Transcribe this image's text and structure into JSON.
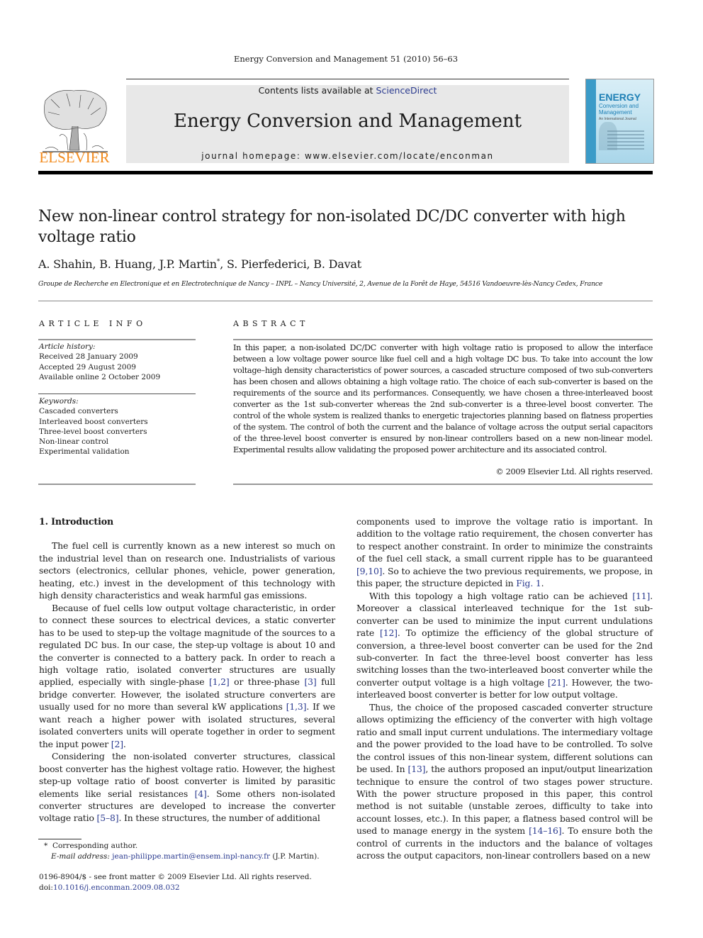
{
  "running_head": "Energy Conversion and Management 51 (2010) 56–63",
  "masthead": {
    "contents_prefix": "Contents lists available at ",
    "contents_link": "ScienceDirect",
    "journal_name": "Energy Conversion and Management",
    "homepage": "journal homepage: www.elsevier.com/locate/enconman",
    "publisher_logo_text": "ELSEVIER",
    "cover": {
      "title_big": "ENERGY",
      "title_small": "Conversion and Management",
      "subtitle": "An International Journal"
    }
  },
  "colors": {
    "elsevier_orange": "#f28a1c",
    "link_blue": "#2a3a8f",
    "banner_gray": "#e8e8e8",
    "cover_blue": "#1d7fb5"
  },
  "article": {
    "title": "New non-linear control strategy for non-isolated DC/DC converter with high voltage ratio",
    "authors": [
      {
        "name": "A. Shahin",
        "mark": ""
      },
      {
        "name": "B. Huang",
        "mark": ""
      },
      {
        "name": "J.P. Martin",
        "mark": "*"
      },
      {
        "name": "S. Pierfederici",
        "mark": ""
      },
      {
        "name": "B. Davat",
        "mark": ""
      }
    ],
    "affiliation": "Groupe de Recherche en Electronique et en Electrotechnique de Nancy – INPL – Nancy Université, 2, Avenue de la Forêt de Haye, 54516 Vandoeuvre-lès-Nancy Cedex, France"
  },
  "article_info": {
    "heading": "ARTICLE INFO",
    "history_label": "Article history:",
    "history": [
      "Received 28 January 2009",
      "Accepted 29 August 2009",
      "Available online 2 October 2009"
    ],
    "keywords_label": "Keywords:",
    "keywords": [
      "Cascaded converters",
      "Interleaved boost converters",
      "Three-level boost converters",
      "Non-linear control",
      "Experimental validation"
    ]
  },
  "abstract": {
    "heading": "ABSTRACT",
    "text": "In this paper, a non-isolated DC/DC converter with high voltage ratio is proposed to allow the interface between a low voltage power source like fuel cell and a high voltage DC bus. To take into account the low voltage–high density characteristics of power sources, a cascaded structure composed of two sub-converters has been chosen and allows obtaining a high voltage ratio. The choice of each sub-converter is based on the requirements of the source and its performances. Consequently, we have chosen a three-interleaved boost converter as the 1st sub-converter whereas the 2nd sub-converter is a three-level boost converter. The control of the whole system is realized thanks to energetic trajectories planning based on flatness properties of the system. The control of both the current and the balance of voltage across the output serial capacitors of the three-level boost converter is ensured by non-linear controllers based on a new non-linear model. Experimental results allow validating the proposed power architecture and its associated control.",
    "copyright": "© 2009 Elsevier Ltd. All rights reserved."
  },
  "body": {
    "section_heading": "1. Introduction",
    "left_paragraphs": [
      [
        {
          "t": "The fuel cell is currently known as a new interest so much on the industrial level than on research one. Industrialists of various sectors (electronics, cellular phones, vehicle, power generation, heating, etc.) invest in the development of this technology with high density characteristics and weak harmful gas emissions."
        }
      ],
      [
        {
          "t": "Because of fuel cells low output voltage characteristic, in order to connect these sources to electrical devices, a static converter has to be used to step-up the voltage magnitude of the sources to a regulated DC bus. In our case, the step-up voltage is about 10 and the converter is connected to a battery pack. In order to reach a high voltage ratio, isolated converter structures are usually applied, especially with single-phase "
        },
        {
          "ref": "[1,2]"
        },
        {
          "t": " or three-phase "
        },
        {
          "ref": "[3]"
        },
        {
          "t": " full bridge converter. However, the isolated structure converters are usually used for no more than several kW applications "
        },
        {
          "ref": "[1,3]"
        },
        {
          "t": ". If we want reach a higher power with isolated structures, several isolated converters units will operate together in order to segment the input power "
        },
        {
          "ref": "[2]"
        },
        {
          "t": "."
        }
      ],
      [
        {
          "t": "Considering the non-isolated converter structures, classical boost converter has the highest voltage ratio. However, the highest step-up voltage ratio of boost converter is limited by parasitic elements like serial resistances "
        },
        {
          "ref": "[4]"
        },
        {
          "t": ". Some others non-isolated converter structures are developed to increase the converter voltage ratio "
        },
        {
          "ref": "[5–8]"
        },
        {
          "t": ". In these structures, the number of additional"
        }
      ]
    ],
    "right_paragraphs": [
      [
        {
          "t": "components used to improve the voltage ratio is important. In addition to the voltage ratio requirement, the chosen converter has to respect another constraint. In order to minimize the constraints of the fuel cell stack, a small current ripple has to be guaranteed "
        },
        {
          "ref": "[9,10]"
        },
        {
          "t": ". So to achieve the two previous requirements, we propose, in this paper, the structure depicted in "
        },
        {
          "ref": "Fig. 1"
        },
        {
          "t": "."
        }
      ],
      [
        {
          "t": "With this topology a high voltage ratio can be achieved "
        },
        {
          "ref": "[11]"
        },
        {
          "t": ". Moreover a classical interleaved technique for the 1st sub-converter can be used to minimize the input current undulations rate "
        },
        {
          "ref": "[12]"
        },
        {
          "t": ". To optimize the efficiency of the global structure of conversion, a three-level boost converter can be used for the 2nd sub-converter. In fact the three-level boost converter has less switching losses than the two-interleaved boost converter while the converter output voltage is a high voltage "
        },
        {
          "ref": "[21]"
        },
        {
          "t": ". However, the two-interleaved boost converter is better for low output voltage."
        }
      ],
      [
        {
          "t": "Thus, the choice of the proposed cascaded converter structure allows optimizing the efficiency of the converter with high voltage ratio and small input current undulations. The intermediary voltage and the power provided to the load have to be controlled. To solve the control issues of this non-linear system, different solutions can be used. In "
        },
        {
          "ref": "[13]"
        },
        {
          "t": ", the authors proposed an input/output linearization technique to ensure the control of two stages power structure. With the power structure proposed in this paper, this control method is not suitable (unstable zeroes, difficulty to take into account losses, etc.). In this paper, a flatness based control will be used to manage energy in the system "
        },
        {
          "ref": "[14–16]"
        },
        {
          "t": ". To ensure both the control of currents in the inductors and the balance of voltages across the output capacitors, non-linear controllers based on a new"
        }
      ]
    ]
  },
  "footnote": {
    "mark": "*",
    "corresponding": "Corresponding author.",
    "email_label": "E-mail address: ",
    "email": "jean-philippe.martin@ensem.inpl-nancy.fr",
    "email_suffix": " (J.P. Martin)."
  },
  "front_matter": {
    "issn_line": "0196-8904/$ - see front matter © 2009 Elsevier Ltd. All rights reserved.",
    "doi_prefix": "doi:",
    "doi": "10.1016/j.enconman.2009.08.032"
  }
}
